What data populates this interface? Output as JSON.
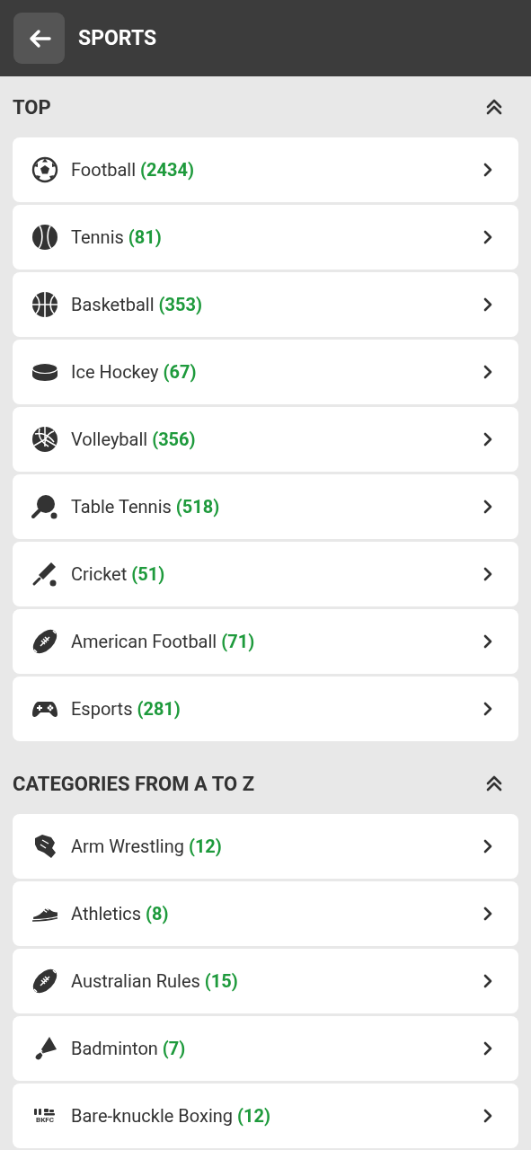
{
  "header": {
    "title": "SPORTS"
  },
  "sections": [
    {
      "title": "TOP",
      "expanded": true,
      "items": [
        {
          "kind": "football",
          "name": "Football",
          "count": "(2434)"
        },
        {
          "kind": "tennis",
          "name": "Tennis",
          "count": "(81)"
        },
        {
          "kind": "basketball",
          "name": "Basketball",
          "count": "(353)"
        },
        {
          "kind": "hockey",
          "name": "Ice Hockey",
          "count": "(67)"
        },
        {
          "kind": "volleyball",
          "name": "Volleyball",
          "count": "(356)"
        },
        {
          "kind": "tabletennis",
          "name": "Table Tennis",
          "count": "(518)"
        },
        {
          "kind": "cricket",
          "name": "Cricket",
          "count": "(51)"
        },
        {
          "kind": "rugby",
          "name": "American Football",
          "count": "(71)"
        },
        {
          "kind": "gamepad",
          "name": "Esports",
          "count": "(281)"
        }
      ]
    },
    {
      "title": "CATEGORIES FROM A TO Z",
      "expanded": true,
      "items": [
        {
          "kind": "armwrestling",
          "name": "Arm Wrestling",
          "count": "(12)"
        },
        {
          "kind": "shoe",
          "name": "Athletics",
          "count": "(8)"
        },
        {
          "kind": "rugby",
          "name": "Australian Rules",
          "count": "(15)"
        },
        {
          "kind": "shuttlecock",
          "name": "Badminton",
          "count": "(7)"
        },
        {
          "kind": "logo",
          "logo_text": "BKFC",
          "name": "Bare-knuckle Boxing",
          "count": "(12)"
        }
      ]
    }
  ]
}
